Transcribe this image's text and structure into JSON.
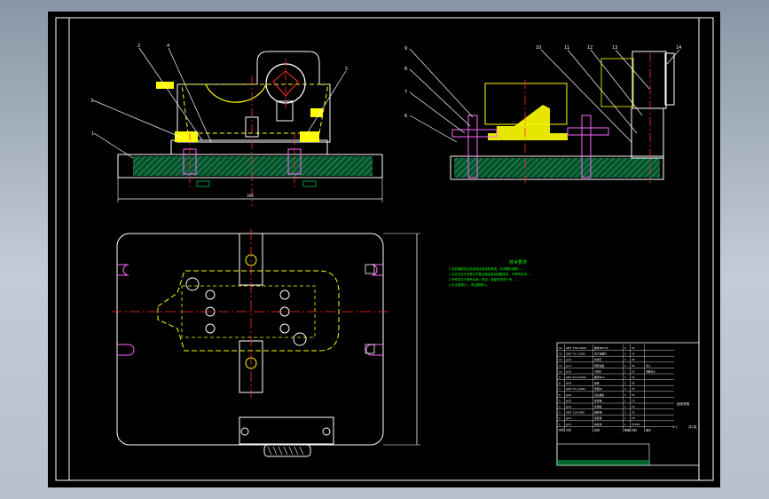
{
  "colors": {
    "background": "#000000",
    "frame": "#ffffff",
    "outline": "#ffffff",
    "part": "#ffff00",
    "hatch": "#00cc66",
    "center": "#ff3030",
    "bolt": "#ff66ff",
    "dimension": "#00ff66",
    "notes": "#00ff00",
    "title_text": "#ffffff"
  },
  "front_view": {
    "balloons": [
      "2",
      "4",
      "5",
      "3",
      "1"
    ],
    "dimension_width": "306"
  },
  "side_view": {
    "balloons": [
      "9",
      "8",
      "7",
      "6",
      "10",
      "11",
      "12",
      "13",
      "14"
    ]
  },
  "technical_notes": {
    "title": "技术要求",
    "lines": [
      "1.夹具装配后应在各结合面涂防锈油，并用螺钉紧固……",
      "2.定位元件与夹紧元件配合面应保证接触良好，不得有松动……",
      "3.所有零件不得有毛刺、锐边，装配前清洗干净……",
      "4.未注倒角C1，未注圆角R2。"
    ]
  },
  "title_block": {
    "bom_rows": [
      [
        "14",
        "GB/T 5783-2000",
        "螺栓M8×25",
        "4",
        "35",
        ""
      ],
      [
        "13",
        "GB/T 70.1-2000",
        "内六角螺钉",
        "2",
        "35",
        ""
      ],
      [
        "12",
        "JJ-12",
        "支承钉",
        "1",
        "45",
        ""
      ],
      [
        "11",
        "JJ-11",
        "侧定位板",
        "1",
        "45",
        "淬火"
      ],
      [
        "10",
        "JJ-10",
        "V形块",
        "1",
        "20",
        "渗碳淬火"
      ],
      [
        "9",
        "GB/T 6170-2000",
        "螺母M10",
        "2",
        "35",
        ""
      ],
      [
        "8",
        "JJ-08",
        "压板",
        "2",
        "45",
        ""
      ],
      [
        "7",
        "GB/T 97.1-2002",
        "垫圈10",
        "2",
        "35",
        ""
      ],
      [
        "6",
        "JJ-06",
        "双头螺柱",
        "2",
        "35",
        ""
      ],
      [
        "5",
        "JJ-05",
        "定位销",
        "1",
        "T8",
        ""
      ],
      [
        "4",
        "JJ-04",
        "支承板",
        "2",
        "20",
        ""
      ],
      [
        "3",
        "GB/T 119-2000",
        "圆柱销",
        "2",
        "35",
        ""
      ],
      [
        "2",
        "JJ-02",
        "菱形销",
        "1",
        "T8",
        ""
      ],
      [
        "1",
        "JJ-01",
        "夹具体",
        "1",
        "HT200",
        ""
      ]
    ],
    "header": [
      "序号",
      "代号",
      "名称",
      "数量",
      "材料",
      "备注"
    ],
    "drawing_name": "钻床夹具",
    "scale": "1:1",
    "sheet": "共1张"
  }
}
